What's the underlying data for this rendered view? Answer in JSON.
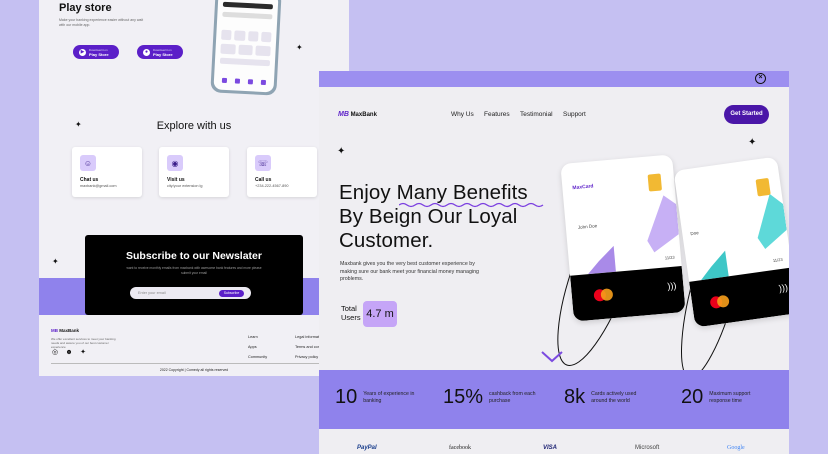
{
  "back_page": {
    "play_store": {
      "title": "Play store",
      "subtitle": "Make your banking experience easier without any wait with our mobile app.",
      "buttons": [
        {
          "caption": "Download it on",
          "label": "Play Store"
        },
        {
          "caption": "Download it on",
          "label": "Play Store"
        }
      ]
    },
    "explore": {
      "title": "Explore with us",
      "cards": [
        {
          "title": "Chat us",
          "value": "maxbank@gmail.com",
          "icon": "chat-icon"
        },
        {
          "title": "Visit us",
          "value": "city/your extension lg",
          "icon": "location-icon"
        },
        {
          "title": "Call us",
          "value": "+234-222-4567-890",
          "icon": "phone-icon"
        }
      ]
    },
    "newsletter": {
      "title": "Subscribe to our Newslater",
      "subtitle": "want to receive monthly emails from maxbank with awesome bank features and more please submit your email",
      "placeholder": "Enter your email",
      "button": "Subscribe"
    },
    "footer": {
      "brand_mark": "MB",
      "brand_name": "MaxBank",
      "description": "We offer excellent services to meet your banking needs and assure you of our best customer experience",
      "col1": [
        "Learn",
        "Apps",
        "Community"
      ],
      "col2": [
        "Legal information",
        "Terms and conditions",
        "Privacy policy"
      ],
      "copyright": "2022 Copyright | Comedy all rights reserved"
    }
  },
  "front_page": {
    "logo_mark": "MB",
    "logo_name": "MaxBank",
    "nav": [
      "Why Us",
      "Features",
      "Testimonial",
      "Support"
    ],
    "cta": "Get Started",
    "hero": {
      "line1_a": "Enjoy ",
      "line1_b": "Many Benefits",
      "line2": "By Beign Our Loyal",
      "line3": "Customer."
    },
    "description": "Maxbank gives you the very best customer experience by making sure our bank meet your financial money managing problems.",
    "total_users": {
      "label_1": "Total",
      "label_2": "Users",
      "value": "4.7 m"
    },
    "cards": [
      {
        "brand": "MaxCard",
        "name": "John Doe",
        "expiry": "11/23"
      },
      {
        "brand": "",
        "name": "Doe",
        "expiry": "11/23"
      }
    ],
    "stats": [
      {
        "number": "10",
        "label": "Years of experience in banking"
      },
      {
        "number": "15%",
        "label": "cashback from each purchase"
      },
      {
        "number": "8k",
        "label": "Cards actively used around the world"
      },
      {
        "number": "20",
        "label": "Maximum support response time"
      }
    ],
    "brands": [
      {
        "name": "PayPal",
        "color": "#1a3e8c"
      },
      {
        "name": "facebook",
        "color": "#222"
      },
      {
        "name": "VISA",
        "color": "#1a1f71"
      },
      {
        "name": "Microsoft",
        "color": "#444"
      },
      {
        "name": "Google",
        "color": "#4285f4"
      }
    ]
  },
  "colors": {
    "background": "#c5c0f2",
    "accent": "#5b1fc8",
    "band": "#8f82ec",
    "highlight": "#c5a5f7"
  }
}
